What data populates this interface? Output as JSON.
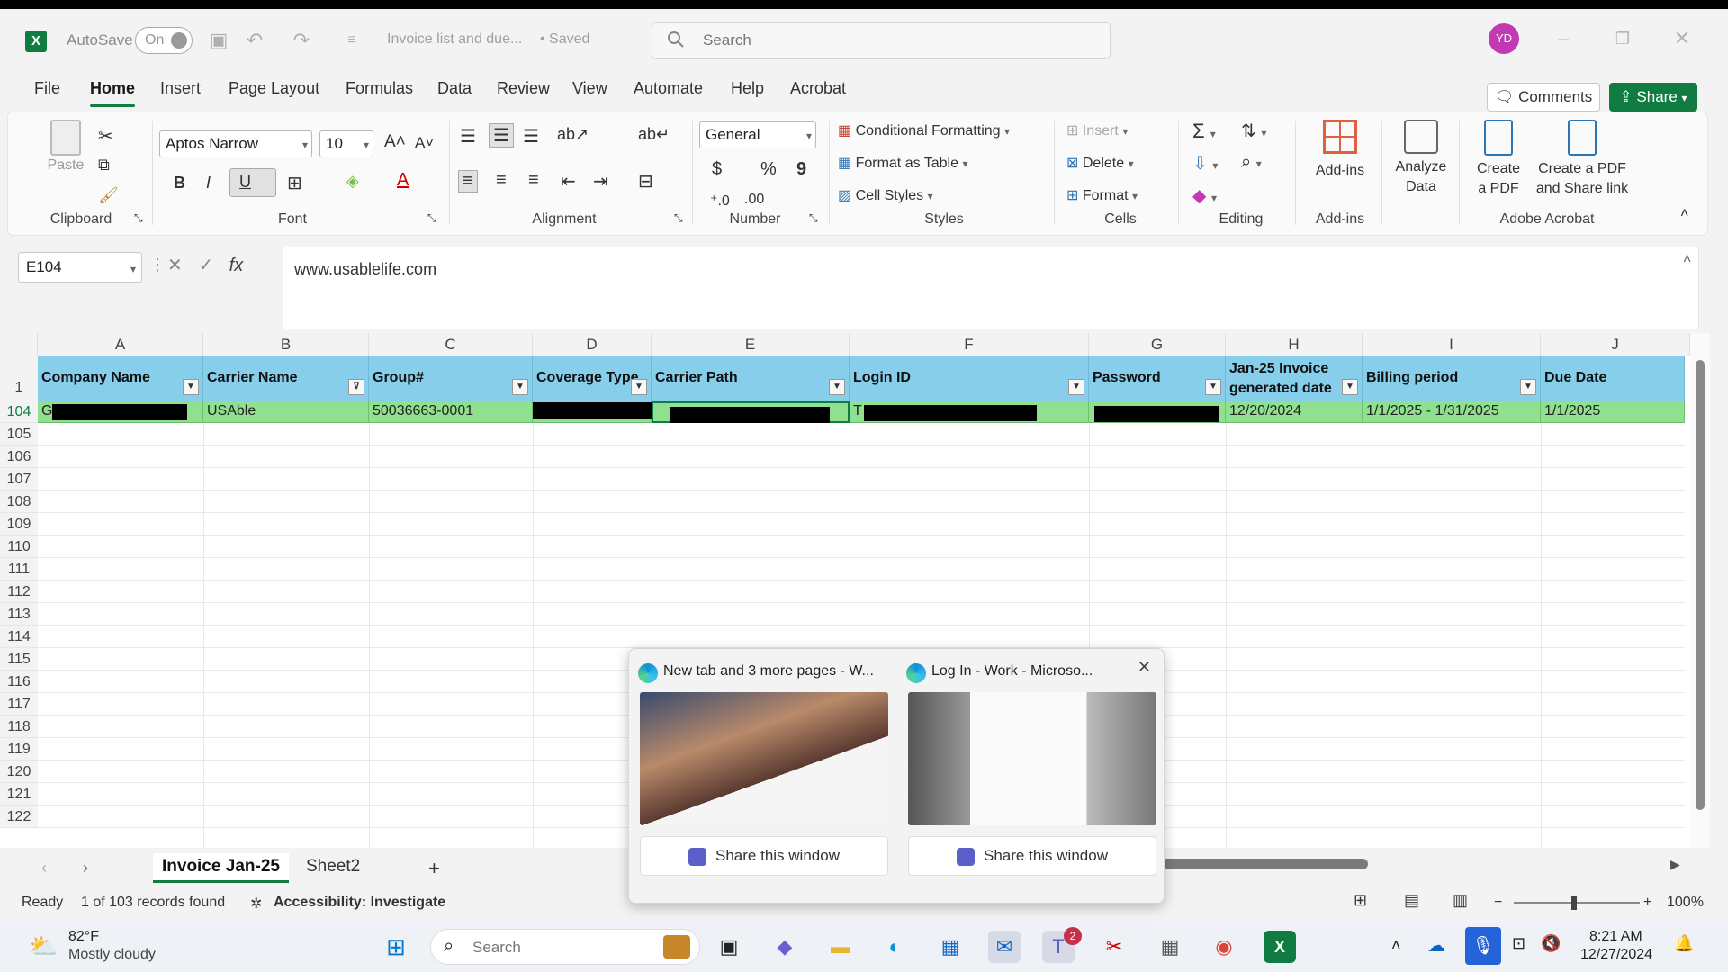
{
  "app": {
    "autosave_label": "AutoSave",
    "autosave_state": "On",
    "doc_title": "Invoice list and due...",
    "doc_status": "• Saved",
    "search_placeholder": "Search",
    "avatar_initials": "YD"
  },
  "menu": {
    "items": [
      "File",
      "Home",
      "Insert",
      "Page Layout",
      "Formulas",
      "Data",
      "Review",
      "View",
      "Automate",
      "Help",
      "Acrobat"
    ],
    "active": "Home",
    "comments_label": "Comments",
    "share_label": "Share"
  },
  "ribbon": {
    "clipboard": {
      "paste_label": "Paste",
      "group": "Clipboard"
    },
    "font": {
      "name": "Aptos Narrow",
      "size": "10",
      "group": "Font",
      "bold": "B",
      "italic": "I",
      "underline": "U"
    },
    "alignment": {
      "group": "Alignment"
    },
    "number": {
      "format": "General",
      "group": "Number",
      "currency": "$",
      "percent": "%",
      "comma": "9"
    },
    "styles": {
      "conditional": "Conditional Formatting",
      "format_table": "Format as Table",
      "cell_styles": "Cell Styles",
      "group": "Styles"
    },
    "cells": {
      "insert": "Insert",
      "delete": "Delete",
      "format": "Format",
      "group": "Cells"
    },
    "editing": {
      "group": "Editing"
    },
    "addins": {
      "label": "Add-ins",
      "group": "Add-ins"
    },
    "analyze": {
      "line1": "Analyze",
      "line2": "Data"
    },
    "acrobat": {
      "create_pdf_1": "Create",
      "create_pdf_2": "a PDF",
      "create_share_1": "Create a PDF",
      "create_share_2": "and Share link",
      "group": "Adobe Acrobat"
    }
  },
  "formula_bar": {
    "name_box": "E104",
    "fx": "fx",
    "value": "www.usablelife.com"
  },
  "grid": {
    "columns": [
      "A",
      "B",
      "C",
      "D",
      "E",
      "F",
      "G",
      "H",
      "I",
      "J"
    ],
    "header_row_num": "1",
    "headers": [
      "Company Name",
      "Carrier Name",
      "Group#",
      "Coverage Type",
      "Carrier Path",
      "Login ID",
      "Password",
      "Jan-25 Invoice generated date",
      "Billing period",
      "Due Date"
    ],
    "selected_row_num": "104",
    "row": {
      "company": "G",
      "carrier": "USAble",
      "group": "50036663-0001",
      "coverage": "",
      "path": "",
      "login": "T",
      "password": "",
      "invoice_date": "12/20/2024",
      "billing": "1/1/2025 - 1/31/2025",
      "due": "1/1/2025"
    },
    "empty_rows": [
      "105",
      "106",
      "107",
      "108",
      "109",
      "110",
      "111",
      "112",
      "113",
      "114",
      "115",
      "116",
      "117",
      "118",
      "119",
      "120",
      "121",
      "122"
    ]
  },
  "sheets": {
    "tabs": [
      "Invoice Jan-25",
      "Sheet2"
    ],
    "active": "Invoice Jan-25",
    "add": "+"
  },
  "status": {
    "ready": "Ready",
    "records": "1 of 103 records found",
    "accessibility": "Accessibility: Investigate",
    "zoom": "100%"
  },
  "popup": {
    "cards": [
      {
        "title": "New tab and 3 more pages - W...",
        "share": "Share this window"
      },
      {
        "title": "Log In - Work - Microso...",
        "share": "Share this window"
      }
    ]
  },
  "taskbar": {
    "weather_temp": "82°F",
    "weather_desc": "Mostly cloudy",
    "search_placeholder": "Search",
    "teams_badge": "2",
    "time": "8:21 AM",
    "date": "12/27/2024"
  }
}
